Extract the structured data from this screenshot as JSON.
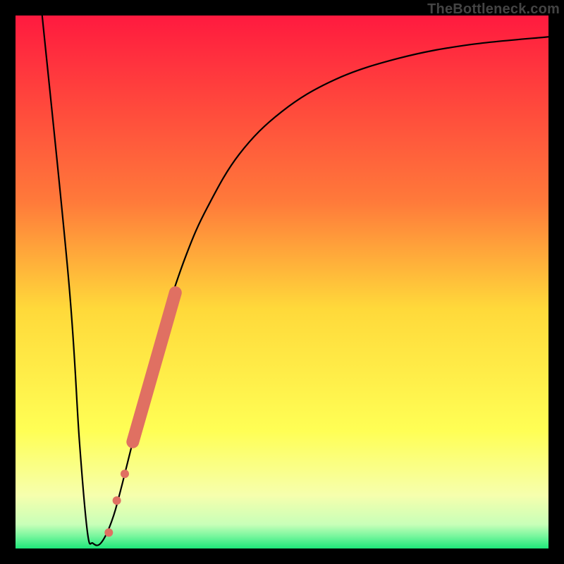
{
  "watermark": {
    "text": "TheBottleneck.com"
  },
  "chart_data": {
    "type": "line",
    "title": "",
    "xlabel": "",
    "ylabel": "",
    "xlim": [
      0,
      100
    ],
    "ylim": [
      0,
      100
    ],
    "background_gradient": {
      "stops": [
        {
          "pos": 0.0,
          "color": "#ff1a3f"
        },
        {
          "pos": 0.35,
          "color": "#ff7a3a"
        },
        {
          "pos": 0.55,
          "color": "#ffd93a"
        },
        {
          "pos": 0.78,
          "color": "#ffff55"
        },
        {
          "pos": 0.9,
          "color": "#f6ffad"
        },
        {
          "pos": 0.955,
          "color": "#c8ffb8"
        },
        {
          "pos": 0.975,
          "color": "#7ef7a0"
        },
        {
          "pos": 1.0,
          "color": "#1ee87a"
        }
      ]
    },
    "curve": [
      {
        "x": 5,
        "y": 100
      },
      {
        "x": 10,
        "y": 50
      },
      {
        "x": 12,
        "y": 20
      },
      {
        "x": 13.5,
        "y": 3
      },
      {
        "x": 14.5,
        "y": 1
      },
      {
        "x": 16,
        "y": 1
      },
      {
        "x": 18,
        "y": 5
      },
      {
        "x": 20,
        "y": 12
      },
      {
        "x": 24,
        "y": 28
      },
      {
        "x": 28,
        "y": 43
      },
      {
        "x": 32,
        "y": 55
      },
      {
        "x": 36,
        "y": 64
      },
      {
        "x": 42,
        "y": 74
      },
      {
        "x": 50,
        "y": 82
      },
      {
        "x": 60,
        "y": 88
      },
      {
        "x": 72,
        "y": 92
      },
      {
        "x": 85,
        "y": 94.5
      },
      {
        "x": 100,
        "y": 96
      }
    ],
    "highlight_segment": {
      "color": "#e07062",
      "thick_radius": 9,
      "dots_radius": 6,
      "thick": [
        {
          "x": 22,
          "y": 20
        },
        {
          "x": 30,
          "y": 48
        }
      ],
      "dots": [
        {
          "x": 20.5,
          "y": 14
        },
        {
          "x": 19.0,
          "y": 9
        },
        {
          "x": 17.5,
          "y": 3
        }
      ]
    }
  }
}
